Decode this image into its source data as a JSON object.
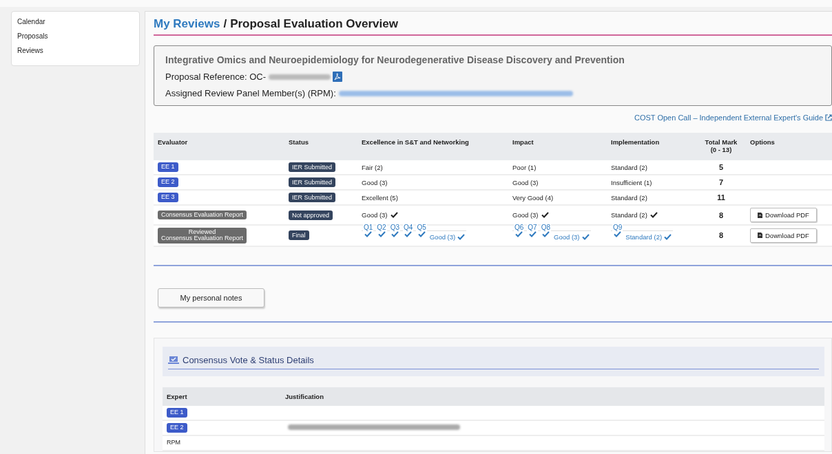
{
  "sidebar": {
    "items": [
      {
        "label": "Calendar",
        "selected": false
      },
      {
        "label": "Proposals",
        "selected": false
      },
      {
        "label": "Reviews",
        "selected": false
      }
    ]
  },
  "breadcrumb": {
    "link": "My Reviews",
    "separator": "/",
    "current": "Proposal Evaluation Overview"
  },
  "proposal": {
    "title": "Integrative Omics and Neuroepidemiology for Neurodegenerative Disease Discovery and Prevention",
    "reference_label": "Proposal Reference:",
    "reference_prefix": "OC-",
    "rpm_label": "Assigned Review Panel Member(s) (RPM):"
  },
  "guide_link": "COST Open Call – Independent External Expert's Guide",
  "table": {
    "columns": [
      "Evaluator",
      "Status",
      "Excellence in S&T and Networking",
      "Impact",
      "Implementation",
      "Total Mark\n(0 - 13)",
      "Options"
    ],
    "rows": [
      {
        "evaluator": {
          "kind": "ee",
          "text": "EE 1"
        },
        "status": "IER Submitted",
        "excellence": {
          "text": "Fair (2)",
          "checked": false
        },
        "impact": {
          "text": "Poor (1)",
          "checked": false
        },
        "implementation": {
          "text": "Standard (2)",
          "checked": false
        },
        "total": "5"
      },
      {
        "evaluator": {
          "kind": "ee",
          "text": "EE 2"
        },
        "status": "IER Submitted",
        "excellence": {
          "text": "Good (3)",
          "checked": false
        },
        "impact": {
          "text": "Good (3)",
          "checked": false
        },
        "implementation": {
          "text": "Insufficient (1)",
          "checked": false
        },
        "total": "7"
      },
      {
        "evaluator": {
          "kind": "ee",
          "text": "EE 3"
        },
        "status": "IER Submitted",
        "excellence": {
          "text": "Excellent (5)",
          "checked": false
        },
        "impact": {
          "text": "Very Good (4)",
          "checked": false
        },
        "implementation": {
          "text": "Standard (2)",
          "checked": false
        },
        "total": "11"
      },
      {
        "evaluator": {
          "kind": "report",
          "text": "Consensus Evaluation Report"
        },
        "status": "Not approved",
        "excellence": {
          "text": "Good (3)",
          "checked": true
        },
        "impact": {
          "text": "Good (3)",
          "checked": true
        },
        "implementation": {
          "text": "Standard (2)",
          "checked": true
        },
        "total": "8",
        "options": "Download PDF"
      },
      {
        "evaluator": {
          "kind": "report",
          "text": "Reviewed\nConsensus Evaluation Report"
        },
        "status": "Final",
        "excellence": {
          "questions": [
            {
              "label": "Q1",
              "checked": true
            },
            {
              "label": "Q2",
              "checked": true
            },
            {
              "label": "Q3",
              "checked": true
            },
            {
              "label": "Q4",
              "checked": true
            },
            {
              "label": "Q5",
              "checked": true
            }
          ],
          "text": "Good (3)",
          "checked": true
        },
        "impact": {
          "questions": [
            {
              "label": "Q6",
              "checked": true
            },
            {
              "label": "Q7",
              "checked": true
            },
            {
              "label": "Q8",
              "checked": true
            }
          ],
          "text": "Good (3)",
          "checked": true
        },
        "implementation": {
          "questions": [
            {
              "label": "Q9",
              "checked": true
            }
          ],
          "text": "Standard (2)",
          "checked": true
        },
        "total": "8",
        "options": "Download PDF"
      }
    ]
  },
  "notes_button": "My personal notes",
  "consensus": {
    "title": "Consensus Vote & Status Details",
    "columns": [
      "Expert",
      "Justification"
    ],
    "rows": [
      {
        "expert": {
          "kind": "ee",
          "text": "EE 1"
        },
        "redacted": false
      },
      {
        "expert": {
          "kind": "ee",
          "text": "EE 2"
        },
        "redacted": true
      },
      {
        "expert": {
          "kind": "plain",
          "text": "RPM"
        },
        "redacted": false
      }
    ]
  }
}
